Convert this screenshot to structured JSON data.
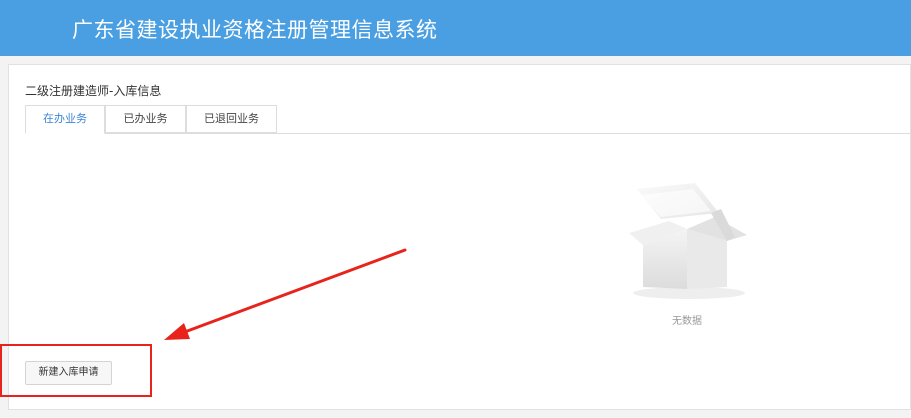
{
  "header": {
    "title": "广东省建设执业资格注册管理信息系统"
  },
  "section": {
    "title": "二级注册建造师-入库信息"
  },
  "tabs": [
    {
      "label": "在办业务",
      "active": true
    },
    {
      "label": "已办业务",
      "active": false
    },
    {
      "label": "已退回业务",
      "active": false
    }
  ],
  "empty_state": {
    "icon": "empty-box-icon",
    "text": "无数据"
  },
  "actions": {
    "new_label": "新建入库申请"
  },
  "annotation": {
    "highlight_color": "#e8231b"
  },
  "colors": {
    "header_bg": "#4a9fe2",
    "active_tab": "#3a86d6"
  }
}
